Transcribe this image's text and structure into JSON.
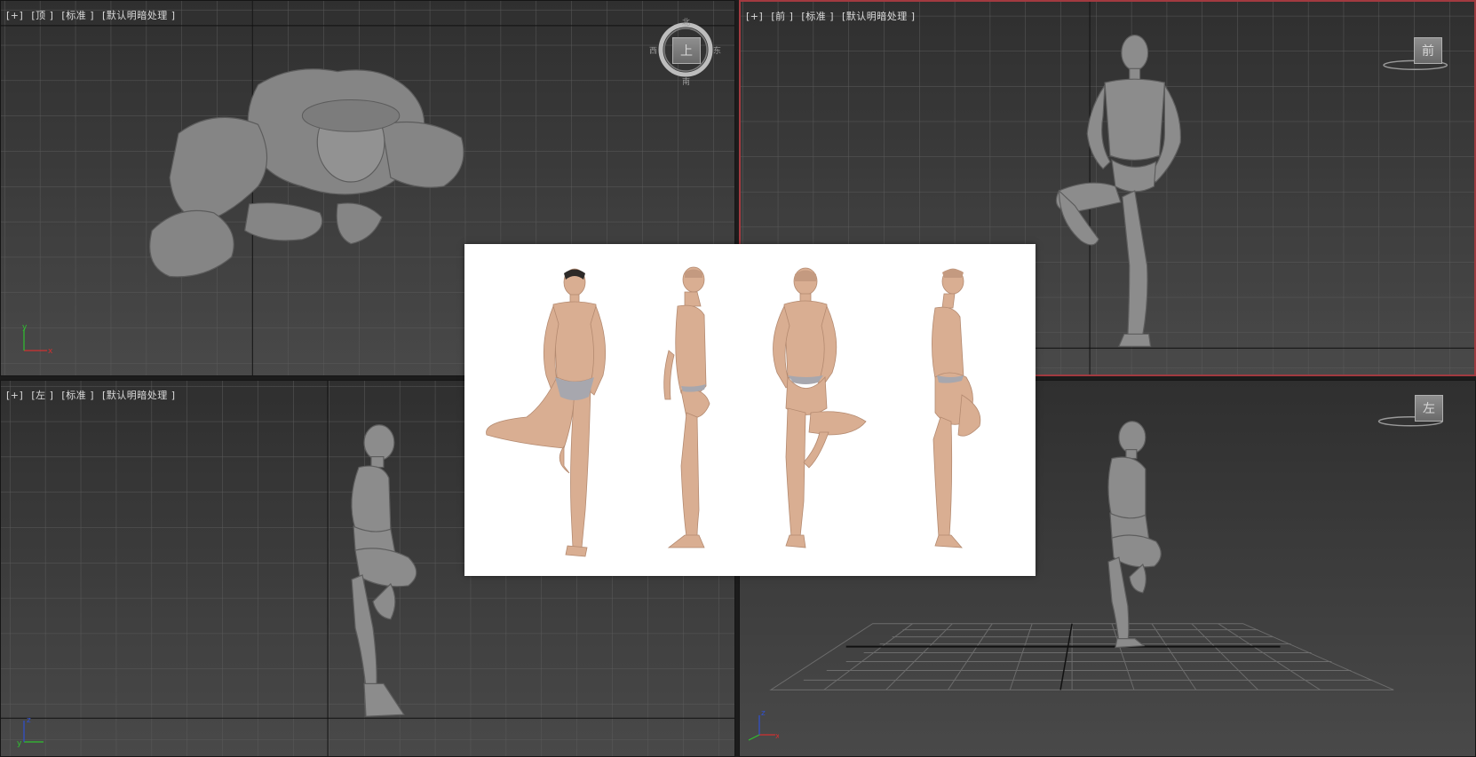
{
  "viewports": {
    "top": {
      "menu": "[+]",
      "view": "[顶 ]",
      "shading": "[标准 ]",
      "lighting": "[默认明暗处理 ]"
    },
    "front": {
      "menu": "[+]",
      "view": "[前 ]",
      "shading": "[标准 ]",
      "lighting": "[默认明暗处理 ]"
    },
    "left": {
      "menu": "[+]",
      "view": "[左 ]",
      "shading": "[标准 ]",
      "lighting": "[默认明暗处理 ]"
    },
    "persp": {
      "menu": "",
      "view": "",
      "shading": "",
      "lighting": ""
    }
  },
  "viewcube": {
    "top": {
      "face": "上",
      "north": "北",
      "south": "南",
      "east": "东",
      "west": "西"
    },
    "front": {
      "face": "前"
    },
    "persp": {
      "face": "左"
    }
  },
  "axes": {
    "top": {
      "h": "x",
      "v": "y"
    },
    "left": {
      "h": "y",
      "v": "z"
    },
    "persp": {
      "h": "x",
      "v": "z"
    }
  },
  "colors": {
    "active_border": "#a23a40",
    "axis_x": "#d03030",
    "axis_y": "#30c030",
    "axis_z": "#3050d0",
    "skin": "#d9ae92",
    "mannequin": "#8a8a8a"
  }
}
